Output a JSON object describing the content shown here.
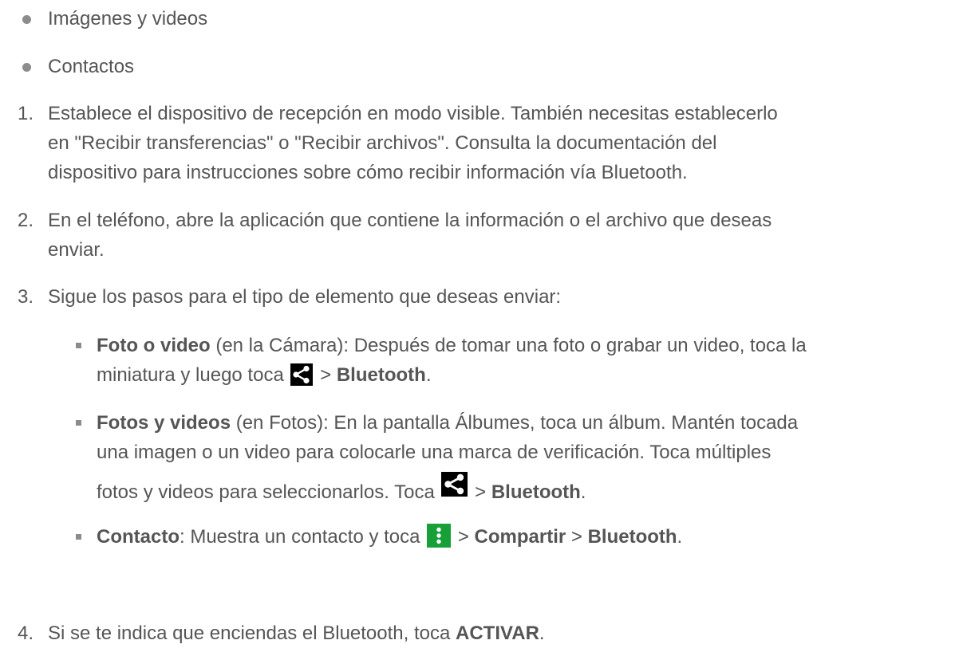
{
  "bullets": [
    {
      "label": "Imágenes y videos"
    },
    {
      "label": "Contactos"
    }
  ],
  "steps": [
    {
      "number": "1.",
      "lines": [
        "Establece el dispositivo de recepción en modo visible. También necesitas establecerlo",
        "en \"Recibir transferencias\" o \"Recibir archivos\". Consulta la documentación del",
        "dispositivo para instrucciones sobre cómo recibir información vía Bluetooth."
      ]
    },
    {
      "number": "2.",
      "lines": [
        "En el teléfono, abre la aplicación que contiene la información o el archivo que deseas",
        "enviar."
      ]
    },
    {
      "number": "3.",
      "lines": [
        "Sigue los pasos para el tipo de elemento que deseas enviar:"
      ]
    },
    {
      "number": "4.",
      "pre": "Si se te indica que enciendas el Bluetooth, toca ",
      "bold": "ACTIVAR",
      "post": "."
    }
  ],
  "substeps": {
    "photo": {
      "title": "Foto o video",
      "line1_rest": " (en la Cámara): Después de tomar una foto o grabar un video, toca la",
      "line2_pre": "miniatura y luego toca ",
      "sep": " > ",
      "target": "Bluetooth",
      "end": "."
    },
    "photos": {
      "title": "Fotos y videos",
      "line1_rest": " (en Fotos): En la pantalla Álbumes, toca un álbum. Mantén tocada",
      "line2": "una imagen o un video para colocarle una marca de verificación. Toca múltiples",
      "line3_pre": "fotos y videos para seleccionarlos. Toca ",
      "sep": " > ",
      "target": "Bluetooth",
      "end": "."
    },
    "contact": {
      "title": "Contacto",
      "rest": ": Muestra un contacto y toca ",
      "sep1": " > ",
      "share": "Compartir",
      "sep2": " > ",
      "target": "Bluetooth",
      "end": "."
    }
  },
  "icons": {
    "share": "share-icon",
    "menu": "more-vert-icon",
    "share_bg": "#000000",
    "menu_bg": "#17a038"
  }
}
